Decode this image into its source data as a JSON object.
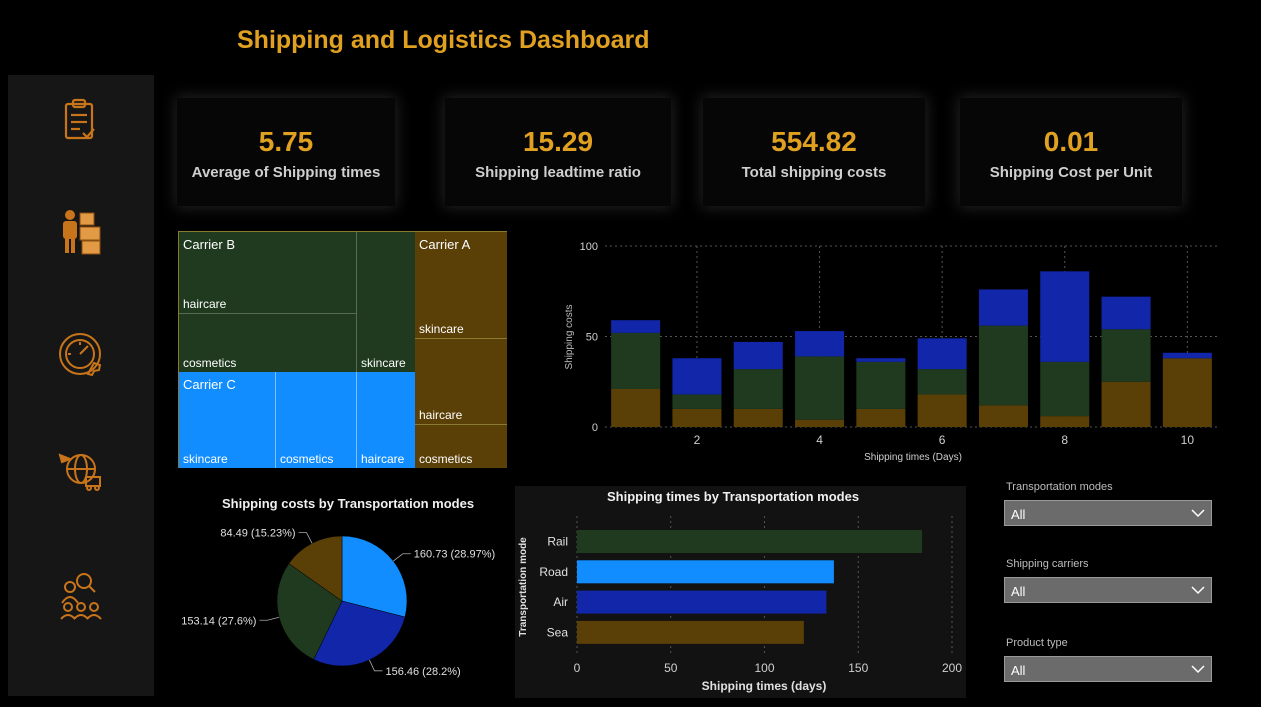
{
  "title": "Shipping and Logistics Dashboard",
  "colors": {
    "accent": "#e0a020",
    "green": "#1f3a1f",
    "blue": "#1126a8",
    "lightblue": "#118dff",
    "brown": "#5a3f07"
  },
  "sidebar": {
    "icons": [
      {
        "name": "clipboard-check-icon"
      },
      {
        "name": "worker-boxes-icon"
      },
      {
        "name": "speed-gear-icon"
      },
      {
        "name": "global-delivery-icon"
      },
      {
        "name": "team-search-icon"
      }
    ]
  },
  "kpis": [
    {
      "value": "5.75",
      "label": "Average of Shipping times"
    },
    {
      "value": "15.29",
      "label": "Shipping leadtime ratio"
    },
    {
      "value": "554.82",
      "label": "Total shipping costs"
    },
    {
      "value": "0.01",
      "label": "Shipping Cost per Unit"
    }
  ],
  "treemap": {
    "carrier_b": "Carrier B",
    "carrier_a": "Carrier A",
    "carrier_c": "Carrier C",
    "b_haircare": "haircare",
    "b_cosmetics": "cosmetics",
    "b_skincare": "skincare",
    "a_skincare": "skincare",
    "a_haircare": "haircare",
    "a_cosmetics": "cosmetics",
    "c_skincare": "skincare",
    "c_cosmetics": "cosmetics",
    "c_haircare": "haircare"
  },
  "stacked_chart": {
    "ylabel": "Shipping costs",
    "xlabel": "Shipping times (Days)"
  },
  "pie_chart": {
    "title": "Shipping costs by Transportation modes"
  },
  "bar_chart": {
    "title": "Shipping times by Transportation modes",
    "xlabel": "Shipping times (days)",
    "ylabel": "Transportation mode"
  },
  "slicers": [
    {
      "label": "Transportation modes",
      "value": "All"
    },
    {
      "label": "Shipping carriers",
      "value": "All"
    },
    {
      "label": "Product type",
      "value": "All"
    }
  ],
  "chart_data": [
    {
      "type": "bar",
      "stacked": true,
      "x": [
        1,
        2,
        3,
        4,
        5,
        6,
        7,
        8,
        9,
        10
      ],
      "series": [
        {
          "color": "#5a3f07",
          "values": [
            21,
            10,
            10,
            4,
            10,
            18,
            12,
            6,
            25,
            38
          ]
        },
        {
          "color": "#1f3a1f",
          "values": [
            31,
            8,
            22,
            35,
            26,
            14,
            44,
            30,
            29,
            0
          ]
        },
        {
          "color": "#1126a8",
          "values": [
            7,
            20,
            15,
            14,
            2,
            17,
            20,
            50,
            18,
            3
          ]
        }
      ],
      "xticks": [
        2,
        4,
        6,
        8,
        10
      ],
      "yticks": [
        0,
        50,
        100
      ],
      "ylim": [
        0,
        100
      ],
      "xlim": [
        0.5,
        10.5
      ],
      "xlabel": "Shipping times (Days)",
      "ylabel": "Shipping costs",
      "grid": true
    },
    {
      "type": "pie",
      "slices": [
        {
          "value": 160.73,
          "label": "160.73 (28.97%)",
          "color": "#118dff"
        },
        {
          "value": 156.46,
          "label": "156.46 (28.2%)",
          "color": "#1126a8"
        },
        {
          "value": 153.14,
          "label": "153.14 (27.6%)",
          "color": "#1f3a1f"
        },
        {
          "value": 84.49,
          "label": "84.49 (15.23%)",
          "color": "#5a3f07"
        }
      ],
      "title": "Shipping costs by Transportation modes"
    },
    {
      "type": "bar",
      "orientation": "horizontal",
      "categories": [
        "Rail",
        "Road",
        "Air",
        "Sea"
      ],
      "values": [
        184,
        137,
        133,
        121
      ],
      "colors": [
        "#1f3a1f",
        "#118dff",
        "#1126a8",
        "#5a3f07"
      ],
      "xticks": [
        0,
        50,
        100,
        150,
        200
      ],
      "xlim": [
        0,
        200
      ],
      "title": "Shipping times by Transportation modes",
      "xlabel": "Shipping times (days)",
      "ylabel": "Transportation mode"
    }
  ]
}
